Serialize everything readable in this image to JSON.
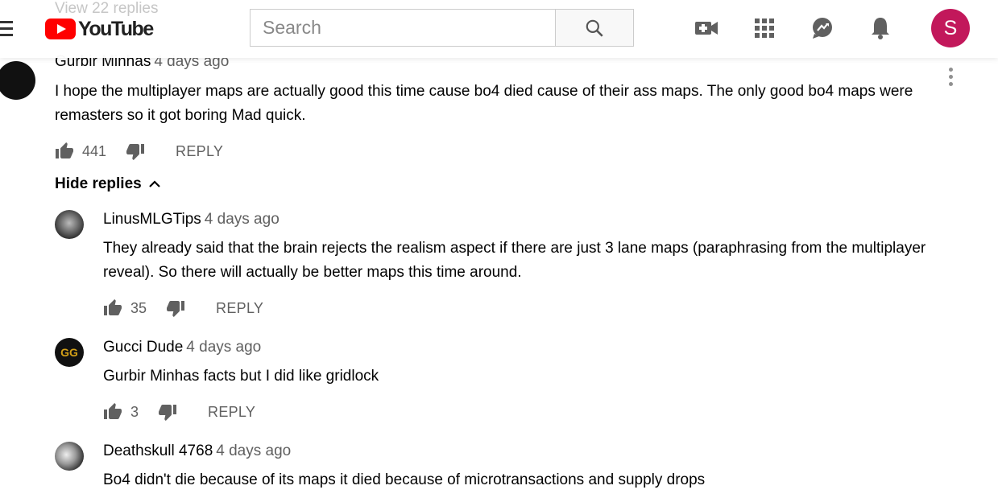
{
  "header": {
    "peek_text": "View 22 replies",
    "logo_text": "YouTube",
    "search_placeholder": "Search",
    "account_initial": "S"
  },
  "top_comment": {
    "author": "Gurbir Minhas",
    "time": "4 days ago",
    "text": "I hope the multiplayer maps are actually good this time cause bo4 died cause of their ass maps. The only good bo4 maps were remasters so it got boring Mad quick.",
    "likes": "441",
    "reply_label": "REPLY"
  },
  "hide_replies_label": "Hide replies",
  "replies": [
    {
      "author": "LinusMLGTips",
      "time": "4 days ago",
      "text": "They already said that the brain rejects the realism aspect if there are just 3 lane maps (paraphrasing from the multiplayer reveal). So there will actually be better maps this time around.",
      "likes": "35",
      "reply_label": "REPLY"
    },
    {
      "author": "Gucci Dude",
      "time": "4 days ago",
      "text": "Gurbir Minhas facts but I did like gridlock",
      "likes": "3",
      "reply_label": "REPLY"
    },
    {
      "author": "Deathskull 4768",
      "time": "4 days ago",
      "text": "Bo4 didn't die because of its maps it died because of microtransactions and supply drops"
    }
  ],
  "colors": {
    "brand": "#ff0000",
    "avatar_bg": "#c2185b",
    "muted": "#606060"
  }
}
